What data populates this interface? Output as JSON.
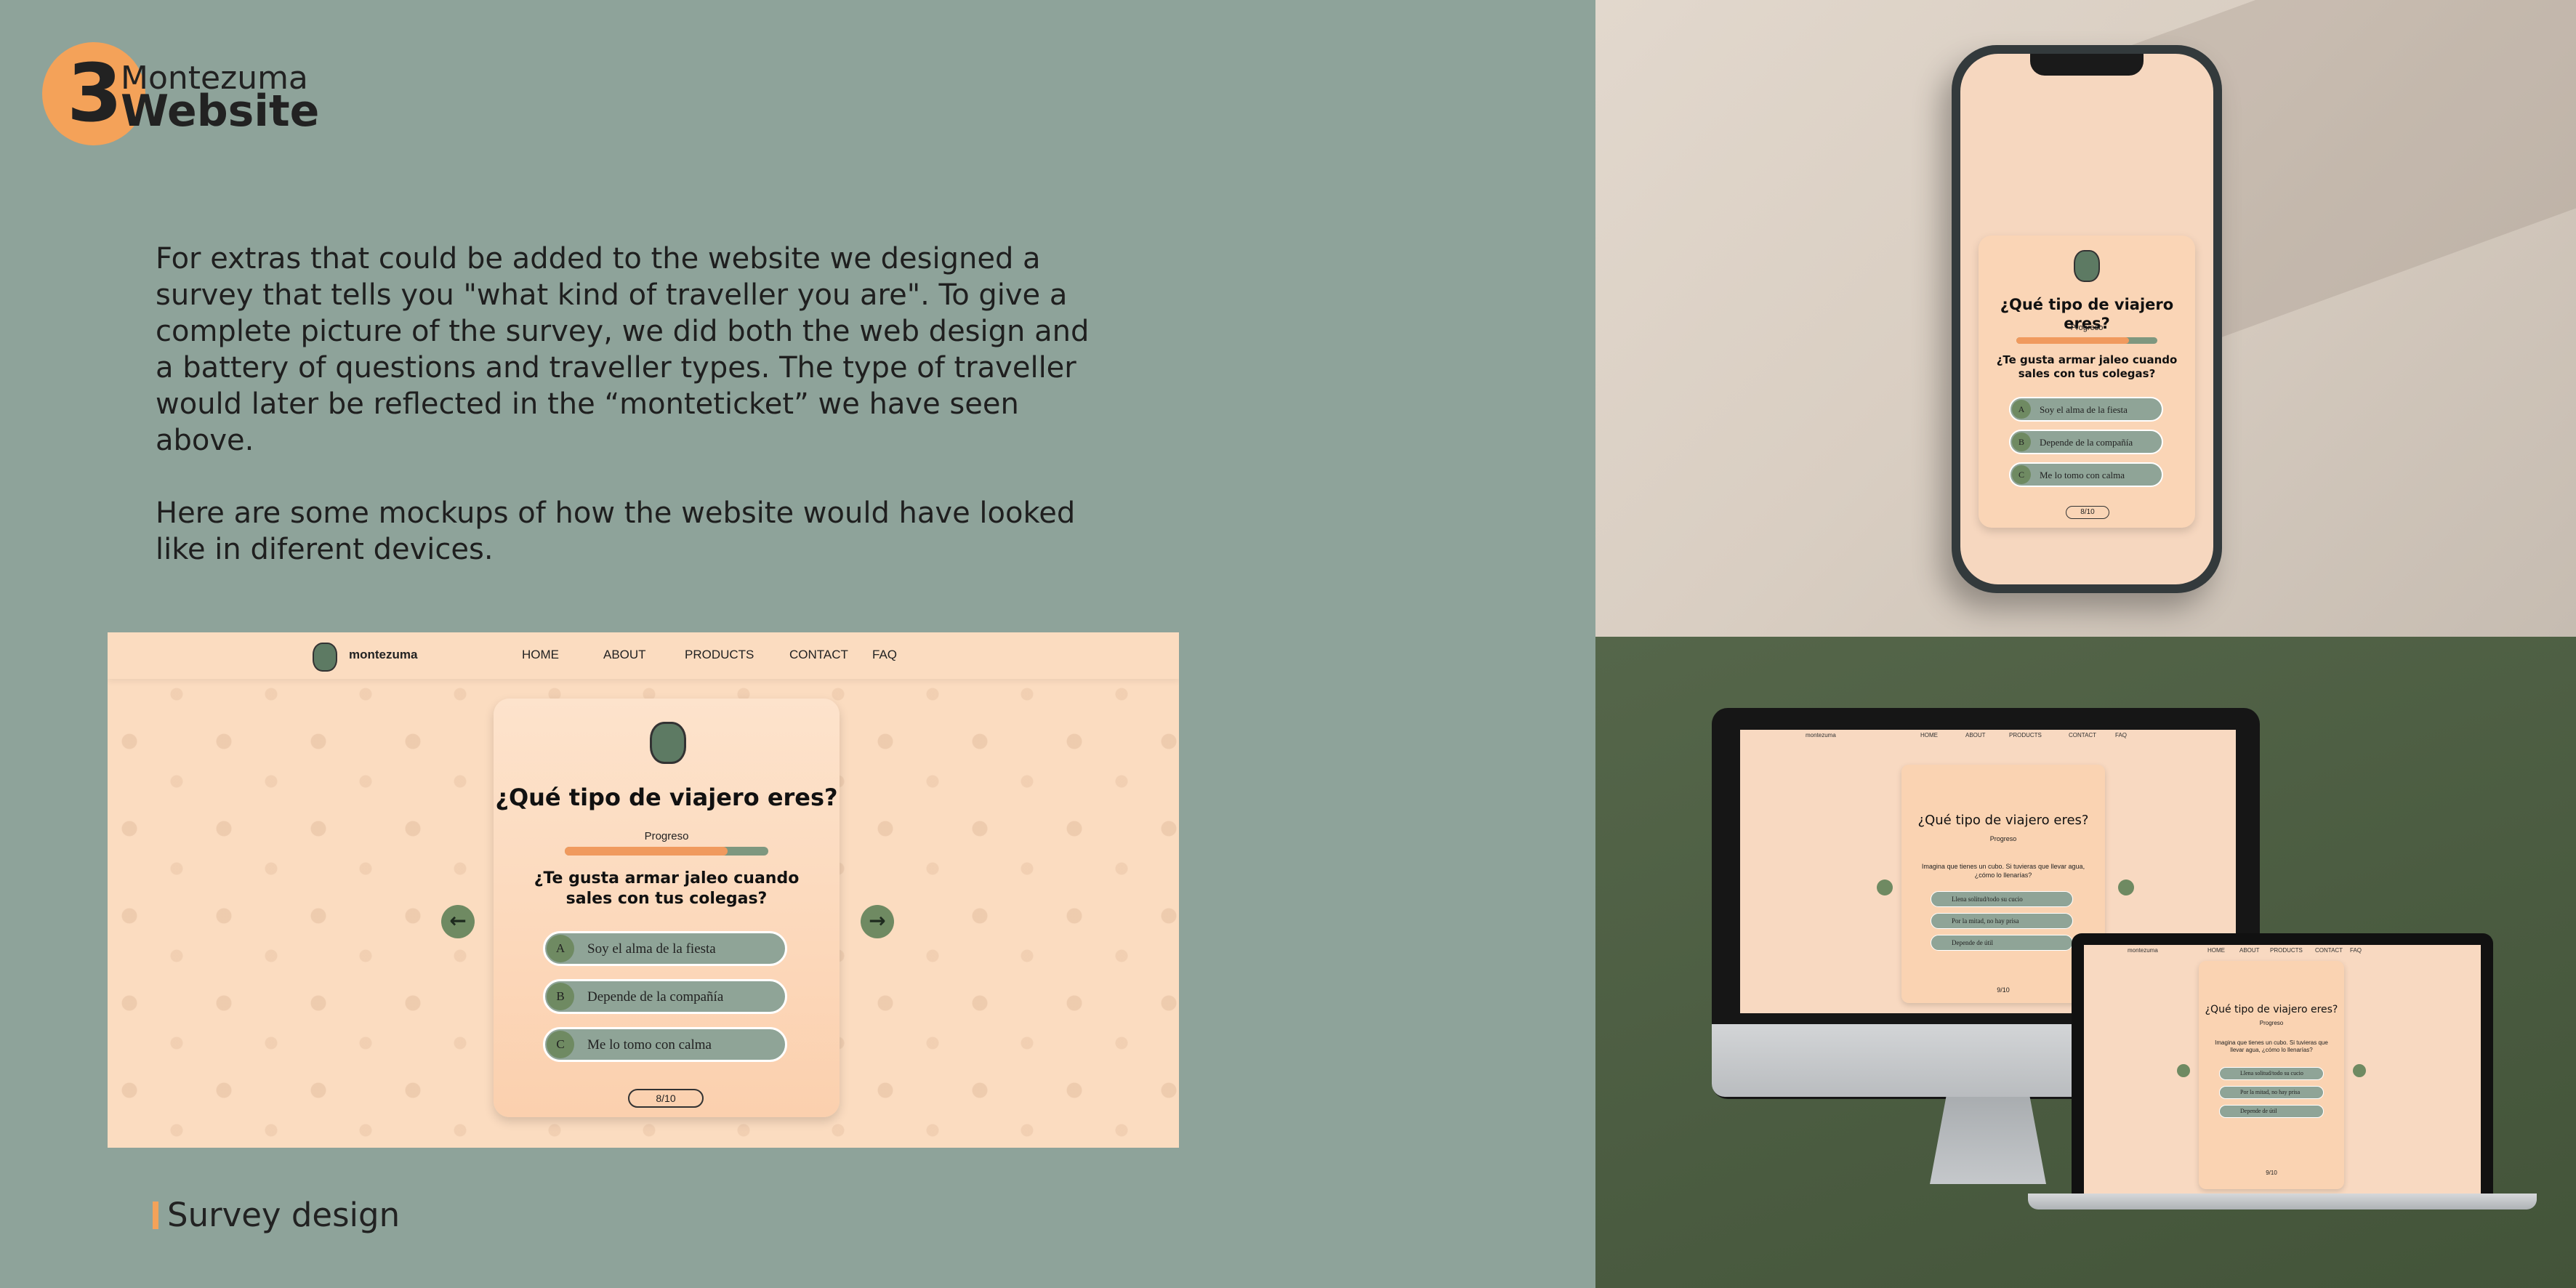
{
  "header": {
    "number": "3",
    "title_line1": "Montezuma",
    "title_line2": "Website"
  },
  "body": {
    "paragraph1": "For extras that could be added to the website we designed a survey that tells you \"what kind of traveller you are\". To give a complete picture of the survey, we did both the web design and a battery of questions and traveller types. The type of traveller would later be reflected in the “monteticket” we have seen above.",
    "paragraph2": "Here are some mockups of how the website would have looked like in diferent devices."
  },
  "caption": "Survey design",
  "site": {
    "brand": "montezuma",
    "nav": [
      "HOME",
      "ABOUT",
      "PRODUCTS",
      "CONTACT",
      "FAQ"
    ],
    "survey": {
      "title": "¿Qué tipo de viajero eres?",
      "progress_label": "Progreso",
      "progress": 0.8,
      "question": "¿Te gusta armar jaleo cuando sales con tus colegas?",
      "options": [
        {
          "letter": "A",
          "text": "Soy el alma de la fiesta"
        },
        {
          "letter": "B",
          "text": "Depende de la compañía"
        },
        {
          "letter": "C",
          "text": "Me lo tomo con calma"
        }
      ],
      "counter": "8/10"
    },
    "arrow_prev_icon": "arrow-left-icon",
    "arrow_next_icon": "arrow-right-icon"
  },
  "devices": {
    "phone_counter": "8/10",
    "imac": {
      "nav": [
        "HOME",
        "ABOUT",
        "PRODUCTS",
        "CONTACT",
        "FAQ"
      ],
      "question": "Imagina que tienes un cubo. Si tuvieras que llevar agua, ¿cómo lo llenarías?",
      "options": [
        "Llena solitud/todo su cucio",
        "Por la mitad, no hay prisa",
        "Depende de útil"
      ],
      "counter": "9/10"
    },
    "laptop": {
      "counter": "9/10"
    }
  },
  "colors": {
    "accent": "#f4a259",
    "background": "#8ea39a",
    "site_bg": "#fbdcc0",
    "option_bg": "#8fa497",
    "progress_fill": "#f09a5e"
  }
}
